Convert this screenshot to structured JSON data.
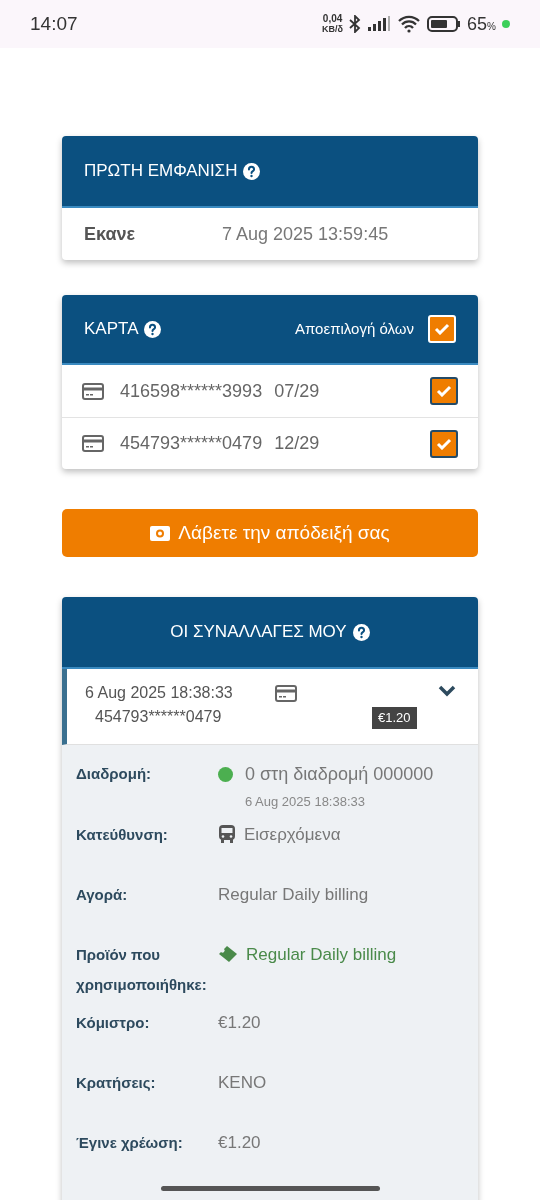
{
  "status_bar": {
    "time": "14:07",
    "net_speed": "0,04",
    "net_unit": "KB/δ",
    "battery_percent": "65",
    "battery_unit": "%"
  },
  "first_seen": {
    "title": "ΠΡΩΤΗ ΕΜΦΑΝΙΣΗ",
    "label": "Εκανε",
    "value": "7 Aug 2025 13:59:45"
  },
  "cards": {
    "title": "ΚΑΡΤΑ",
    "select_all_label": "Αποεπιλογή όλων",
    "select_all_checked": true,
    "items": [
      {
        "number": "416598******3993",
        "expiry": "07/29",
        "checked": true
      },
      {
        "number": "454793******0479",
        "expiry": "12/29",
        "checked": true
      }
    ]
  },
  "receipt_button": {
    "label": "Λάβετε την απόδειξή σας"
  },
  "transactions": {
    "title": "ΟΙ ΣΥΝΑΛΛΑΓΕΣ ΜΟΥ",
    "items": [
      {
        "date": "6 Aug 2025 18:38:33",
        "card": "454793******0479",
        "amount": "€1.20",
        "expanded": true,
        "details": [
          {
            "kind": "route",
            "label": "Διαδρομή:",
            "value": "0 στη διαδρομή 000000",
            "subvalue": "6 Aug 2025 18:38:33",
            "color": "#4caf50"
          },
          {
            "kind": "direction",
            "label": "Κατεύθυνση:",
            "value": "Εισερχόμενα"
          },
          {
            "kind": "plain",
            "label": "Αγορά:",
            "value": "Regular Daily billing"
          },
          {
            "kind": "product",
            "label": "Προϊόν που χρησιμοποιήθηκε:",
            "value": "Regular Daily billing"
          },
          {
            "kind": "plain",
            "label": "Κόμιστρο:",
            "value": "€1.20"
          },
          {
            "kind": "plain",
            "label": "Κρατήσεις:",
            "value": "KENO"
          },
          {
            "kind": "plain",
            "label": "Έγινε χρέωση:",
            "value": "€1.20"
          }
        ]
      }
    ]
  }
}
